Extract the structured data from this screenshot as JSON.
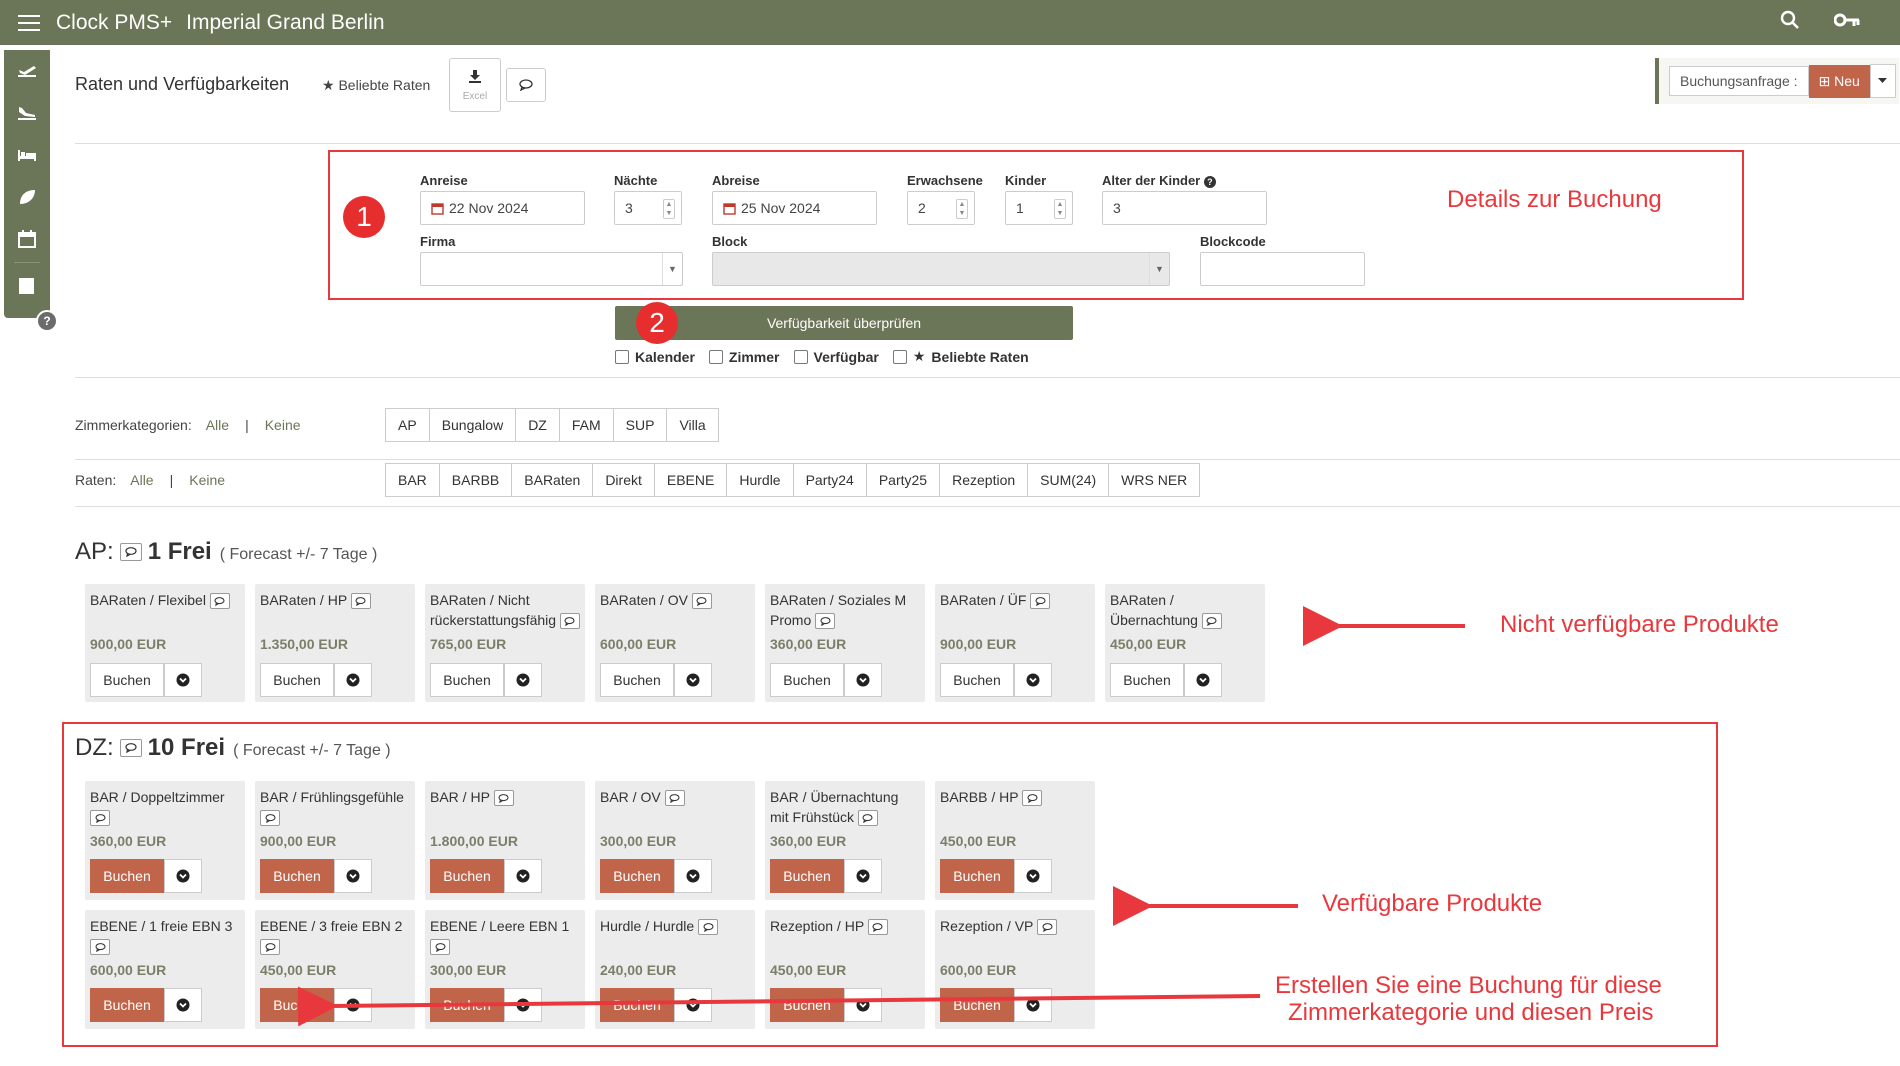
{
  "app": {
    "title": "Clock PMS+",
    "hotel": "Imperial Grand Berlin"
  },
  "sidebar": {
    "icons": [
      "departure-icon",
      "arrival-icon",
      "bed-icon",
      "leaf-icon",
      "calendar-icon",
      "bookmark-icon"
    ]
  },
  "header": {
    "title": "Raten und Verfügbarkeiten",
    "favorites": "Beliebte Raten",
    "excel": "Excel",
    "booking_request": "Buchungsanfrage :",
    "new": "Neu"
  },
  "form": {
    "arrival_label": "Anreise",
    "arrival": "22 Nov 2024",
    "nights_label": "Nächte",
    "nights": "3",
    "departure_label": "Abreise",
    "departure": "25 Nov 2024",
    "adults_label": "Erwachsene",
    "adults": "2",
    "children_label": "Kinder",
    "children": "1",
    "child_age_label": "Alter der Kinder",
    "child_age": "3",
    "company_label": "Firma",
    "company": "",
    "block_label": "Block",
    "block": "",
    "blockcode_label": "Blockcode",
    "blockcode": ""
  },
  "check_button": "Verfügbarkeit überprüfen",
  "checkboxes": [
    "Kalender",
    "Zimmer",
    "Verfügbar",
    "Beliebte Raten"
  ],
  "room_filter": {
    "label": "Zimmerkategorien:",
    "all": "Alle",
    "sep": "|",
    "none": "Keine",
    "items": [
      "AP",
      "Bungalow",
      "DZ",
      "FAM",
      "SUP",
      "Villa"
    ]
  },
  "rate_filter": {
    "label": "Raten:",
    "all": "Alle",
    "sep": "|",
    "none": "Keine",
    "items": [
      "BAR",
      "BARBB",
      "BARaten",
      "Direkt",
      "EBENE",
      "Hurdle",
      "Party24",
      "Party25",
      "Rezeption",
      "SUM(24)",
      "WRS NER"
    ]
  },
  "annotations": {
    "badge1": "1",
    "badge2": "2",
    "details": "Details zur Buchung",
    "unavailable": "Nicht verfügbare Produkte",
    "available": "Verfügbare Produkte",
    "create_line1": "Erstellen Sie eine Buchung für diese",
    "create_line2": "Zimmerkategorie und diesen Preis"
  },
  "categories": [
    {
      "code": "AP:",
      "free": "1 Frei",
      "forecast": "( Forecast +/- 7 Tage )",
      "products": [
        {
          "name": "BARaten / Flexibel",
          "price": "900,00 EUR",
          "book": "Buchen",
          "available": false
        },
        {
          "name": "BARaten / HP",
          "price": "1.350,00 EUR",
          "book": "Buchen",
          "available": false
        },
        {
          "name": "BARaten / Nicht rückerstattungsfähig",
          "price": "765,00 EUR",
          "book": "Buchen",
          "available": false
        },
        {
          "name": "BARaten / OV",
          "price": "600,00 EUR",
          "book": "Buchen",
          "available": false
        },
        {
          "name": "BARaten / Soziales M Promo",
          "price": "360,00 EUR",
          "book": "Buchen",
          "available": false
        },
        {
          "name": "BARaten / ÜF",
          "price": "900,00 EUR",
          "book": "Buchen",
          "available": false
        },
        {
          "name": "BARaten / Übernachtung",
          "price": "450,00 EUR",
          "book": "Buchen",
          "available": false
        }
      ]
    },
    {
      "code": "DZ:",
      "free": "10 Frei",
      "forecast": "( Forecast +/- 7 Tage )",
      "products": [
        {
          "name": "BAR / Doppeltzimmer",
          "price": "360,00 EUR",
          "book": "Buchen",
          "available": true
        },
        {
          "name": "BAR / Frühlingsgefühle",
          "price": "900,00 EUR",
          "book": "Buchen",
          "available": true
        },
        {
          "name": "BAR / HP",
          "price": "1.800,00 EUR",
          "book": "Buchen",
          "available": true
        },
        {
          "name": "BAR / OV",
          "price": "300,00 EUR",
          "book": "Buchen",
          "available": true
        },
        {
          "name": "BAR / Übernachtung mit Frühstück",
          "price": "360,00 EUR",
          "book": "Buchen",
          "available": true
        },
        {
          "name": "BARBB / HP",
          "price": "450,00 EUR",
          "book": "Buchen",
          "available": true
        },
        {
          "name": "EBENE / 1 freie EBN 3",
          "price": "600,00 EUR",
          "book": "Buchen",
          "available": true
        },
        {
          "name": "EBENE / 3 freie EBN 2",
          "price": "450,00 EUR",
          "book": "Buchen",
          "available": true
        },
        {
          "name": "EBENE / Leere EBN 1",
          "price": "300,00 EUR",
          "book": "Buchen",
          "available": true
        },
        {
          "name": "Hurdle / Hurdle",
          "price": "240,00 EUR",
          "book": "Buchen",
          "available": true
        },
        {
          "name": "Rezeption / HP",
          "price": "450,00 EUR",
          "book": "Buchen",
          "available": true
        },
        {
          "name": "Rezeption / VP",
          "price": "600,00 EUR",
          "book": "Buchen",
          "available": true
        }
      ]
    }
  ]
}
